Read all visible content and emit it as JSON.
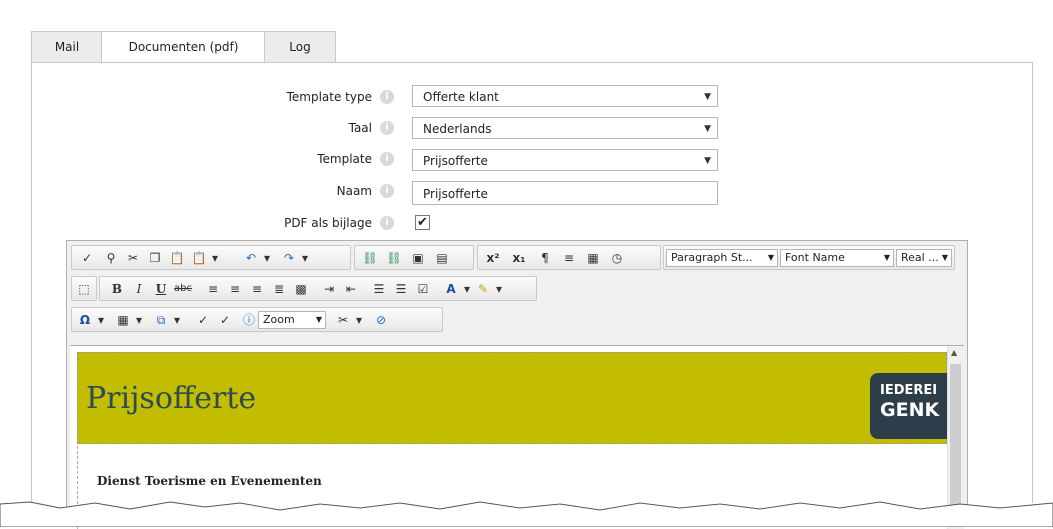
{
  "tabs": [
    {
      "label": "Mail"
    },
    {
      "label": "Documenten (pdf)"
    },
    {
      "label": "Log"
    }
  ],
  "form": {
    "template_type": {
      "label": "Template type",
      "value": "Offerte klant"
    },
    "taal": {
      "label": "Taal",
      "value": "Nederlands"
    },
    "template": {
      "label": "Template",
      "value": "Prijsofferte"
    },
    "naam": {
      "label": "Naam",
      "value": "Prijsofferte"
    },
    "pdf": {
      "label": "PDF als bijlage",
      "checked": true
    }
  },
  "toolbar": {
    "paragraph_style": "Paragraph St...",
    "font_name": "Font Name",
    "real": "Real ...",
    "zoom": "Zoom"
  },
  "document": {
    "title": "Prijsofferte",
    "logo_line1": "IEDEREI",
    "logo_line2": "GENK",
    "section": "Dienst Toerisme en Evenementen"
  },
  "colors": {
    "banner": "#c2bd00",
    "title": "#2e4a52",
    "logo_bg": "#2e3d4a"
  }
}
